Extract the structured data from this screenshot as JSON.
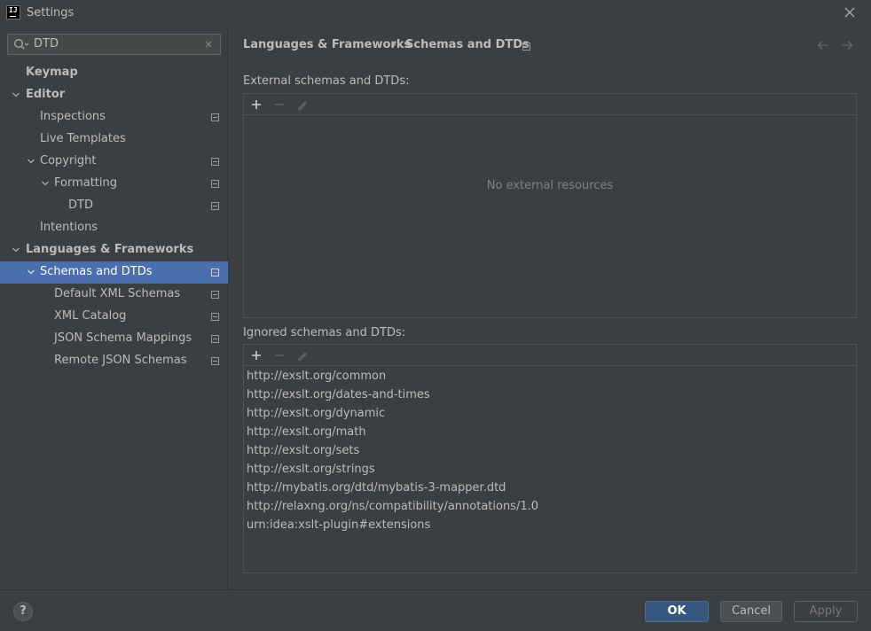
{
  "window": {
    "title": "Settings",
    "logo_text": "IJ"
  },
  "search": {
    "value": "DTD"
  },
  "sidebar": {
    "items": [
      {
        "label": "Keymap"
      },
      {
        "label": "Editor"
      },
      {
        "label": "Inspections"
      },
      {
        "label": "Live Templates"
      },
      {
        "label": "Copyright"
      },
      {
        "label": "Formatting"
      },
      {
        "label": "DTD"
      },
      {
        "label": "Intentions"
      },
      {
        "label": "Languages & Frameworks"
      },
      {
        "label": "Schemas and DTDs"
      },
      {
        "label": "Default XML Schemas"
      },
      {
        "label": "XML Catalog"
      },
      {
        "label": "JSON Schema Mappings"
      },
      {
        "label": "Remote JSON Schemas"
      }
    ]
  },
  "breadcrumb": {
    "parent": "Languages & Frameworks",
    "separator": "›",
    "current": "Schemas and DTDs"
  },
  "external": {
    "label": "External schemas and DTDs:",
    "empty_text": "No external resources"
  },
  "ignored": {
    "label": "Ignored schemas and DTDs:",
    "items": [
      "http://exslt.org/common",
      "http://exslt.org/dates-and-times",
      "http://exslt.org/dynamic",
      "http://exslt.org/math",
      "http://exslt.org/sets",
      "http://exslt.org/strings",
      "http://mybatis.org/dtd/mybatis-3-mapper.dtd",
      "http://relaxng.org/ns/compatibility/annotations/1.0",
      "urn:idea:xslt-plugin#extensions"
    ]
  },
  "footer": {
    "help_label": "?",
    "ok_label": "OK",
    "cancel_label": "Cancel",
    "apply_label": "Apply"
  },
  "colors": {
    "background": "#3c3f41",
    "selection": "#4b6eaf",
    "primary_button": "#365880",
    "text": "#bbbbbb"
  }
}
